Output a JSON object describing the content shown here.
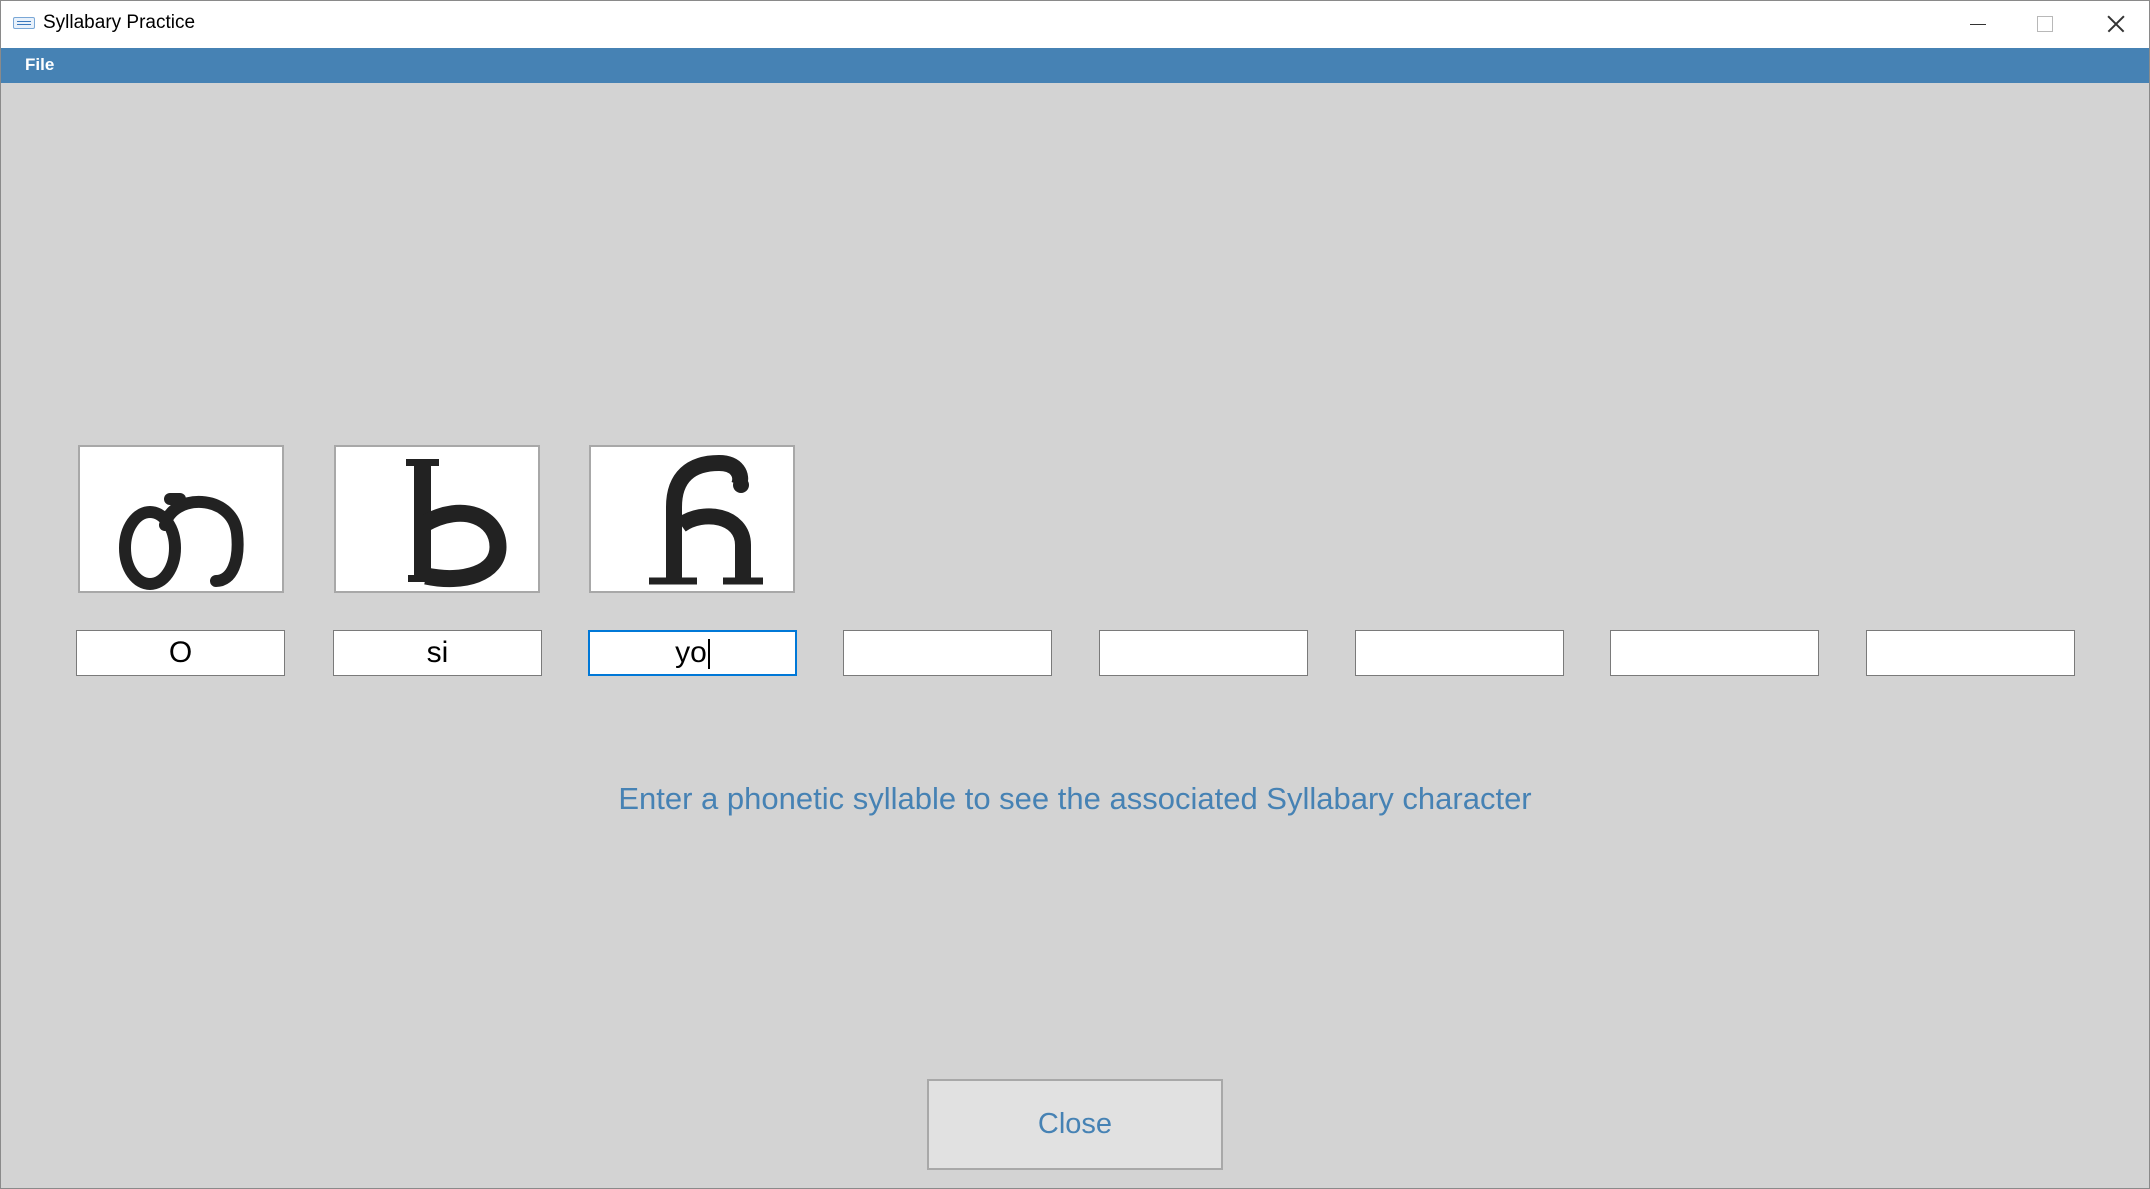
{
  "window": {
    "title": "Syllabary Practice",
    "icons": [
      "app-icon",
      "minimize-icon",
      "maximize-icon",
      "close-icon"
    ]
  },
  "menu": {
    "file_label": "File"
  },
  "characters": [
    {
      "glyph": "Ꭳ",
      "syllable": "o"
    },
    {
      "glyph": "Ꮟ",
      "syllable": "si"
    },
    {
      "glyph": "Ᏺ",
      "syllable": "yo"
    }
  ],
  "inputs": [
    {
      "value": "O",
      "focused": false
    },
    {
      "value": "si",
      "focused": false
    },
    {
      "value": "yo",
      "focused": true
    },
    {
      "value": "",
      "focused": false
    },
    {
      "value": "",
      "focused": false
    },
    {
      "value": "",
      "focused": false
    },
    {
      "value": "",
      "focused": false
    },
    {
      "value": "",
      "focused": false
    }
  ],
  "hint": "Enter a phonetic syllable to see the associated Syllabary character",
  "close_button_label": "Close",
  "colors": {
    "accent": "#4682b4",
    "background": "#d3d3d3",
    "focus": "#0078d7"
  }
}
